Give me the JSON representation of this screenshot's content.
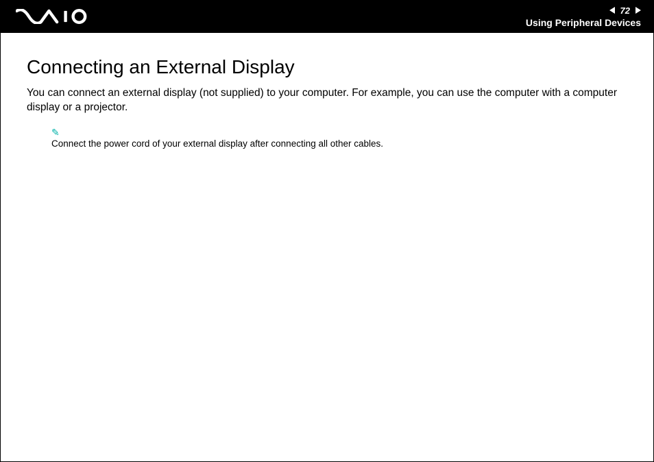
{
  "header": {
    "logo_alt": "VAIO",
    "page_number": "72",
    "section": "Using Peripheral Devices"
  },
  "content": {
    "title": "Connecting an External Display",
    "paragraph": "You can connect an external display (not supplied) to your computer. For example, you can use the computer with a computer display or a projector.",
    "note_icon": "✎",
    "note_text": "Connect the power cord of your external display after connecting all other cables."
  }
}
